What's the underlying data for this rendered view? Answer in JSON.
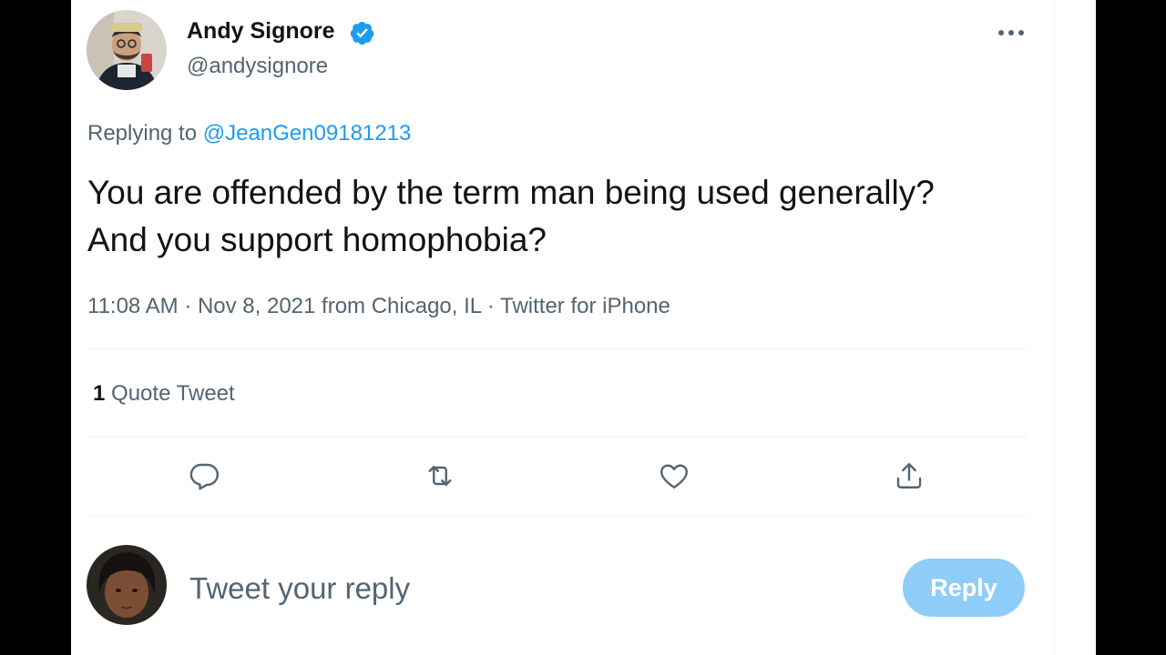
{
  "author": {
    "name": "Andy Signore",
    "handle": "@andysignore",
    "verified": true,
    "avatar_icon": "avatar-man-with-glasses"
  },
  "more_icon": "more-horizontal-icon",
  "tweet": {
    "replying_prefix": "Replying to",
    "replying_to": "@JeanGen09181213",
    "text": "You are offended by the term man being used generally? And you support homophobia?",
    "timestamp": "11:08 AM · Nov 8, 2021 from Chicago, IL · Twitter for iPhone"
  },
  "stats": {
    "quote_count": "1",
    "quote_label": "Quote Tweet"
  },
  "actions": [
    {
      "name": "reply",
      "icon": "comment-bubble-icon"
    },
    {
      "name": "retweet",
      "icon": "retweet-icon"
    },
    {
      "name": "like",
      "icon": "heart-icon"
    },
    {
      "name": "share",
      "icon": "share-icon"
    }
  ],
  "compose": {
    "placeholder": "Tweet your reply",
    "button_label": "Reply",
    "avatar_icon": "avatar-user"
  },
  "colors": {
    "link": "#1d9bf0",
    "reply_button": "#8ecdf8",
    "verified_badge": "#1d9bf0",
    "secondary_text": "#536471"
  }
}
